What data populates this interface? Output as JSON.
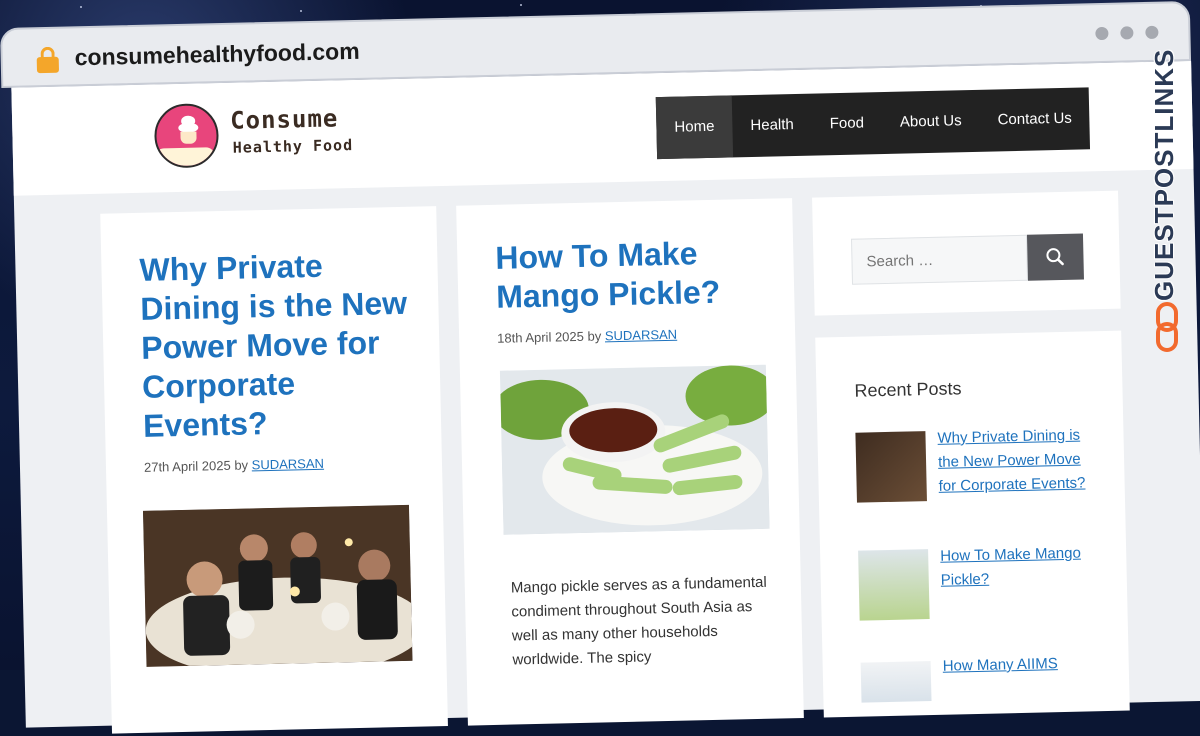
{
  "browser": {
    "url": "consumehealthyfood.com"
  },
  "site": {
    "logo_title": "Consume",
    "logo_subtitle": "Healthy Food",
    "nav": [
      "Home",
      "Health",
      "Food",
      "About Us",
      "Contact Us"
    ]
  },
  "posts": [
    {
      "title": "Why Private Dining is the New Power Move for Corporate Events?",
      "date": "27th April 2025",
      "by": "by",
      "author": "SUDARSAN"
    },
    {
      "title": "How To Make Mango Pickle?",
      "date": "18th April 2025",
      "by": "by",
      "author": "SUDARSAN",
      "excerpt": "Mango pickle serves as a fundamental condiment throughout South Asia as well as many other households worldwide. The spicy"
    }
  ],
  "sidebar": {
    "search_placeholder": "Search …",
    "recent_title": "Recent Posts",
    "recent_posts": [
      "Why Private Dining is the New Power Move for Corporate Events?",
      "How To Make Mango Pickle?",
      "How Many AIIMS"
    ]
  },
  "watermark": "GUESTPOSTLINKS",
  "colors": {
    "link": "#1e72bd",
    "nav_bg": "#222222",
    "watermark_accent": "#f26a2e"
  }
}
